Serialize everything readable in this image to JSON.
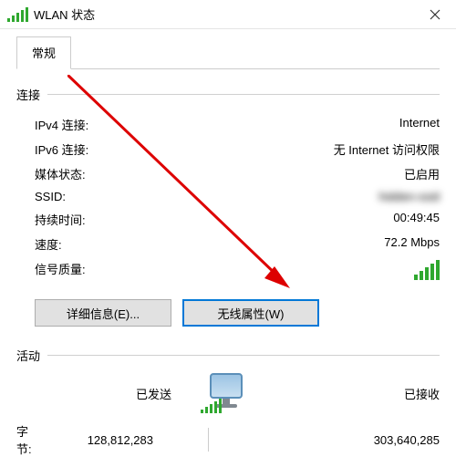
{
  "titlebar": {
    "title": "WLAN 状态"
  },
  "tabs": {
    "general": "常规"
  },
  "connection": {
    "header": "连接",
    "ipv4_label": "IPv4 连接:",
    "ipv4_value": "Internet",
    "ipv6_label": "IPv6 连接:",
    "ipv6_value": "无 Internet 访问权限",
    "media_label": "媒体状态:",
    "media_value": "已启用",
    "ssid_label": "SSID:",
    "ssid_value": "hidden-ssid",
    "duration_label": "持续时间:",
    "duration_value": "00:49:45",
    "speed_label": "速度:",
    "speed_value": "72.2 Mbps",
    "signal_label": "信号质量:"
  },
  "buttons": {
    "details": "详细信息(E)...",
    "wireless_props": "无线属性(W)"
  },
  "activity": {
    "header": "活动",
    "sent": "已发送",
    "received": "已接收",
    "bytes_label": "字节:",
    "bytes_sent": "128,812,283",
    "bytes_recv": "303,640,285"
  }
}
